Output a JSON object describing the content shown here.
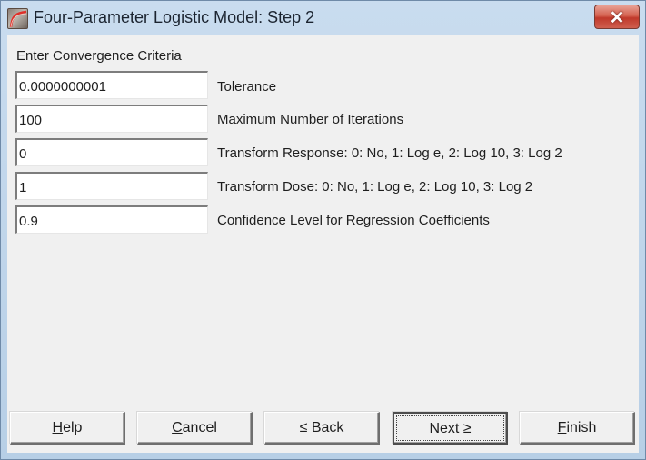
{
  "window": {
    "title": "Four-Parameter Logistic Model: Step 2",
    "close_label": "✕"
  },
  "form": {
    "section_label": "Enter Convergence Criteria",
    "fields": [
      {
        "value": "0.0000000001",
        "label": "Tolerance"
      },
      {
        "value": "100",
        "label": "Maximum Number of Iterations"
      },
      {
        "value": "0",
        "label": "Transform Response: 0: No, 1: Log e, 2: Log 10, 3: Log 2"
      },
      {
        "value": "1",
        "label": "Transform Dose: 0: No, 1: Log e, 2: Log 10, 3: Log 2"
      },
      {
        "value": "0.9",
        "label": "Confidence Level for Regression Coefficients"
      }
    ]
  },
  "buttons": {
    "help": {
      "mnemonic": "H",
      "rest": "elp"
    },
    "cancel": {
      "mnemonic": "C",
      "rest": "ancel"
    },
    "back": {
      "mnemonic": "<",
      "rest": " Back",
      "mnemonic_display": "≤"
    },
    "next": {
      "rest": "Next ",
      "mnemonic": ">",
      "mnemonic_display": "≥"
    },
    "finish": {
      "mnemonic": "F",
      "rest": "inish"
    }
  }
}
